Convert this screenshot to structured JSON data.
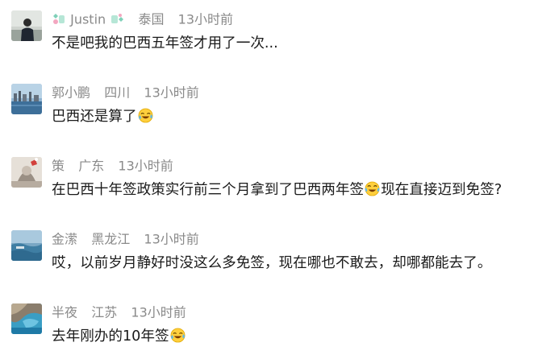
{
  "comments": [
    {
      "user": "Justin",
      "location": "泰国",
      "time": "13小时前",
      "text_before": "不是吧我的巴西五年签才用了一次...",
      "emoji": "",
      "text_after": ""
    },
    {
      "user": "郭小鹏",
      "location": "四川",
      "time": "13小时前",
      "text_before": "巴西还是算了",
      "emoji": "laughing-crying-emoji",
      "text_after": ""
    },
    {
      "user": "策",
      "location": "广东",
      "time": "13小时前",
      "text_before": "在巴西十年签政策实行前三个月拿到了巴西两年签",
      "emoji": "tears-of-joy-emoji",
      "text_after": "现在直接迈到免签?"
    },
    {
      "user": "金潆",
      "location": "黑龙江",
      "time": "13小时前",
      "text_before": "哎，以前岁月静好时没这么多免签，现在哪也不敢去，却哪都能去了。",
      "emoji": "",
      "text_after": ""
    },
    {
      "user": "半夜",
      "location": "江苏",
      "time": "13小时前",
      "text_before": "去年刚办的10年签",
      "emoji": "laughing-crying-emoji",
      "text_after": ""
    }
  ],
  "colors": {
    "meta": "#8a8a8a",
    "text": "#1a1a1a",
    "decoration": "#7fd0b8"
  }
}
